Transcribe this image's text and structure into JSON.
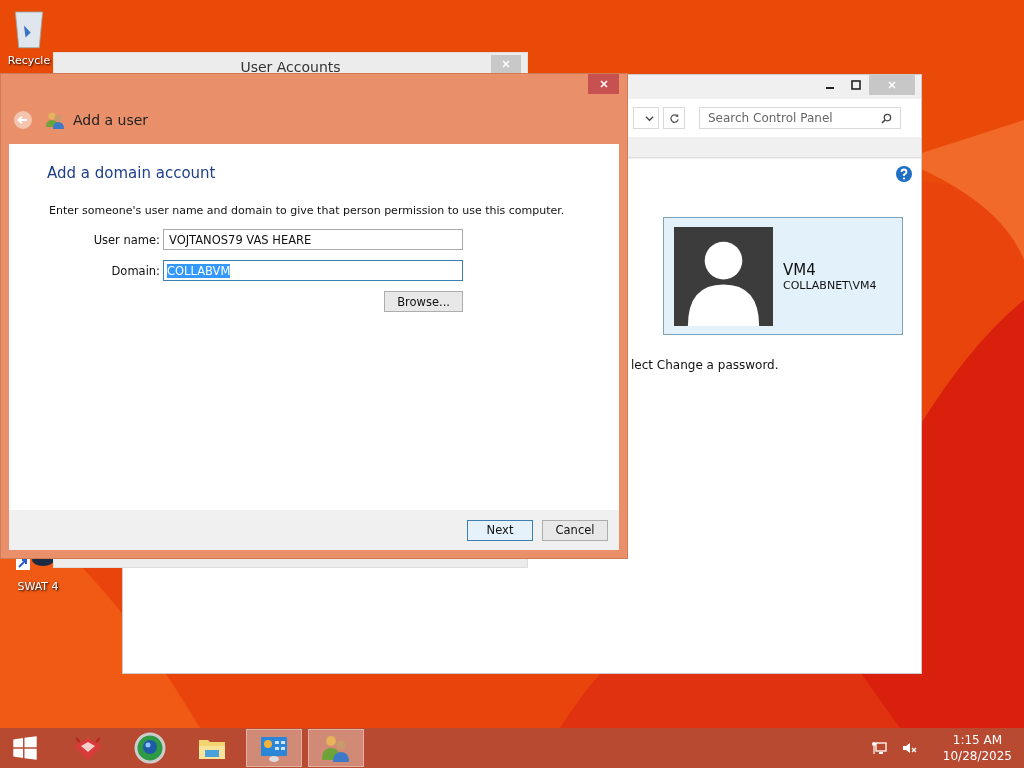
{
  "desktop_icons": [
    {
      "kind": "recycle",
      "label": "Recycle"
    },
    {
      "kind": "shortcut",
      "label": "SWAT 4"
    }
  ],
  "back_window": {
    "title": "User Accounts"
  },
  "control_panel": {
    "search": {
      "placeholder": "Search Control Panel"
    },
    "account": {
      "name": "VM4",
      "domain": "COLLABNET\\VM4"
    },
    "hint": "lect Change a password."
  },
  "dialog": {
    "title": "Add a user",
    "heading": "Add a domain account",
    "instructions": "Enter someone's user name and domain to give that person permission to use this computer.",
    "fields": [
      {
        "label": "User name:",
        "value": "VOJTANOS79 VAS HEARE",
        "selected": false
      },
      {
        "label": "Domain:",
        "value": "COLLABVM",
        "selected": true
      }
    ],
    "browse": "Browse...",
    "buttons": [
      {
        "label": "Next",
        "default": true
      },
      {
        "label": "Cancel",
        "default": false
      }
    ]
  },
  "taskbar": {
    "apps": [
      {
        "kind": "toolbox",
        "active": false
      },
      {
        "kind": "browser",
        "active": false
      },
      {
        "kind": "folder",
        "active": false
      },
      {
        "kind": "control-panel",
        "active": true
      },
      {
        "kind": "users",
        "active": true
      }
    ],
    "clock": {
      "time": "1:15 AM",
      "date": "10/28/2025"
    }
  }
}
